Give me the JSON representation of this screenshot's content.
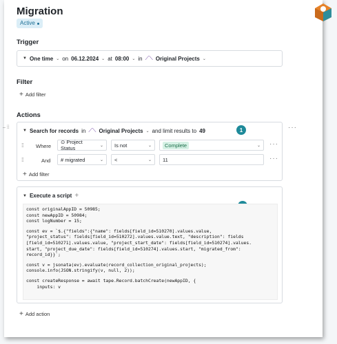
{
  "page": {
    "title": "Migration",
    "status": "Active"
  },
  "trigger": {
    "heading": "Trigger",
    "mode": "One time",
    "on_word": "on",
    "date": "06.12.2024",
    "at_word": "at",
    "time": "08:00",
    "in_word": "in",
    "app": "Original Projects"
  },
  "filter": {
    "heading": "Filter",
    "add_label": "Add filter"
  },
  "actions": {
    "heading": "Actions",
    "search": {
      "prefix": "Search for records",
      "in_word": "in",
      "app": "Original Projects",
      "suffix": "and limit results to",
      "limit": "49",
      "step_number": "1",
      "conditions": [
        {
          "join": "Where",
          "field": "Project Status",
          "operator": "Is not",
          "value": "Complete"
        },
        {
          "join": "And",
          "field": "migrated",
          "operator": "<",
          "value": "11"
        }
      ],
      "add_filter_label": "Add filter"
    },
    "script": {
      "label": "Execute a script",
      "step_number": "2",
      "code_lines": [
        "const originalAppID = 50985;",
        "const newAppID = 50984;",
        "const logNumber = 15;",
        "",
        "const ev = `$.{\"fields\":{\"name\": fields[field_id=510270].values.value,",
        "\"project_status\": fields[field_id=510272].values.value.text, \"description\": fields",
        "[field_id=510271].values.value, \"project_start_date\": fields[field_id=510274].values.",
        "start, \"project_due_date\": fields[field_id=510274].values.start, \"migrated_from\":",
        "record_id}}`;",
        "",
        "const v = jsonata(ev).evaluate(record_collection_original_projects);",
        "console.info(JSON.stringify(v, null, 2));",
        "",
        "const createResponse = await tape.Record.batchCreate(newAppID, {",
        "    inputs: v"
      ]
    },
    "add_action_label": "Add action"
  },
  "colors": {
    "accent": "#1e8a9a",
    "badge_bg": "#dbeef7",
    "tag_bg": "#d6f1e5",
    "logo_orange": "#e6832a"
  },
  "icons": [
    "caret-down-icon",
    "chevron-down-icon",
    "app-icon",
    "plus-icon",
    "drag-handle-icon",
    "more-icon",
    "circle-icon",
    "hash-icon",
    "logo-icon"
  ]
}
